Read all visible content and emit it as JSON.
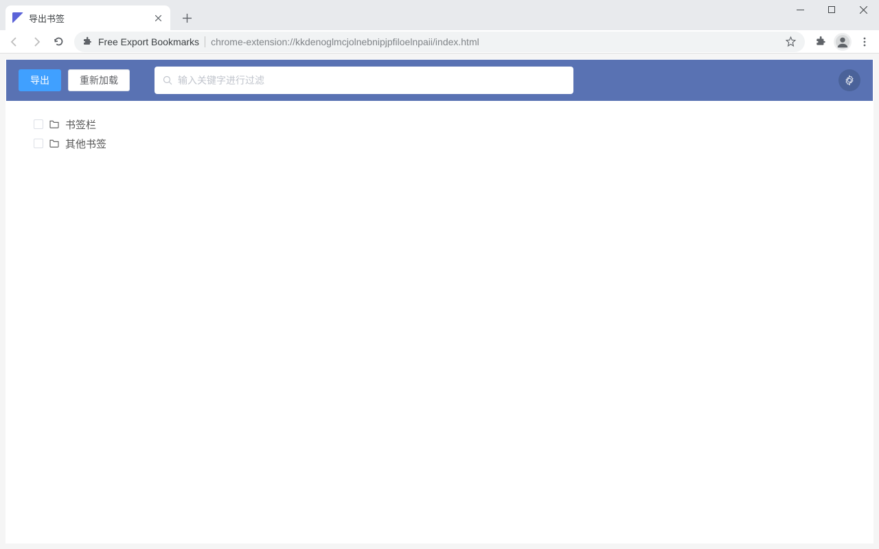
{
  "browser": {
    "tab": {
      "title": "导出书签"
    },
    "extension_name": "Free Export Bookmarks",
    "url": "chrome-extension://kkdenoglmcjolnebnipjpfiloelnpaii/index.html"
  },
  "header": {
    "export_label": "导出",
    "reload_label": "重新加载",
    "search_placeholder": "输入关键字进行过滤"
  },
  "tree": {
    "items": [
      {
        "label": "书签栏"
      },
      {
        "label": "其他书签"
      }
    ]
  }
}
